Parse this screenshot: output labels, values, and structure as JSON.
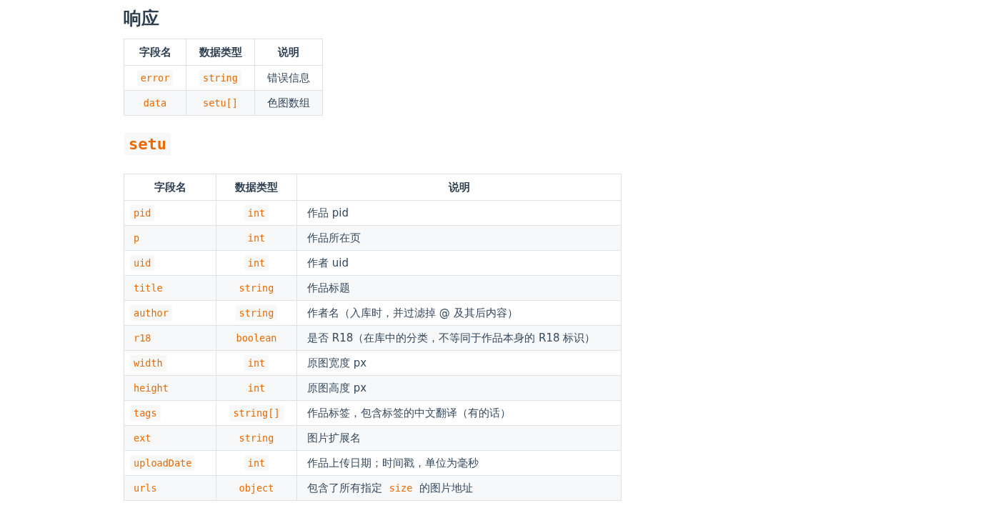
{
  "response": {
    "heading": "响应",
    "table": {
      "columns": [
        "字段名",
        "数据类型",
        "说明"
      ],
      "rows": [
        {
          "field": "error",
          "type": "string",
          "description": [
            {
              "kind": "text",
              "text": "错误信息"
            }
          ]
        },
        {
          "field": "data",
          "type": "setu[]",
          "description": [
            {
              "kind": "text",
              "text": "色图数组"
            }
          ]
        }
      ]
    }
  },
  "setu": {
    "heading": "setu",
    "table": {
      "columns": [
        "字段名",
        "数据类型",
        "说明"
      ],
      "rows": [
        {
          "field": "pid",
          "type": "int",
          "description": [
            {
              "kind": "text",
              "text": "作品 pid"
            }
          ]
        },
        {
          "field": "p",
          "type": "int",
          "description": [
            {
              "kind": "text",
              "text": "作品所在页"
            }
          ]
        },
        {
          "field": "uid",
          "type": "int",
          "description": [
            {
              "kind": "text",
              "text": "作者 uid"
            }
          ]
        },
        {
          "field": "title",
          "type": "string",
          "description": [
            {
              "kind": "text",
              "text": "作品标题"
            }
          ]
        },
        {
          "field": "author",
          "type": "string",
          "description": [
            {
              "kind": "text",
              "text": "作者名（入库时，并过滤掉 @ 及其后内容）"
            }
          ]
        },
        {
          "field": "r18",
          "type": "boolean",
          "description": [
            {
              "kind": "text",
              "text": "是否 R18（在库中的分类，不等同于作品本身的 R18 标识）"
            }
          ]
        },
        {
          "field": "width",
          "type": "int",
          "description": [
            {
              "kind": "text",
              "text": "原图宽度 px"
            }
          ]
        },
        {
          "field": "height",
          "type": "int",
          "description": [
            {
              "kind": "text",
              "text": "原图高度 px"
            }
          ]
        },
        {
          "field": "tags",
          "type": "string[]",
          "description": [
            {
              "kind": "text",
              "text": "作品标签，包含标签的中文翻译（有的话）"
            }
          ]
        },
        {
          "field": "ext",
          "type": "string",
          "description": [
            {
              "kind": "text",
              "text": "图片扩展名"
            }
          ]
        },
        {
          "field": "uploadDate",
          "type": "int",
          "description": [
            {
              "kind": "text",
              "text": "作品上传日期；时间戳，单位为毫秒"
            }
          ]
        },
        {
          "field": "urls",
          "type": "object",
          "description": [
            {
              "kind": "text",
              "text": "包含了所有指定 "
            },
            {
              "kind": "code",
              "text": "size"
            },
            {
              "kind": "text",
              "text": " 的图片地址"
            }
          ]
        }
      ]
    }
  }
}
